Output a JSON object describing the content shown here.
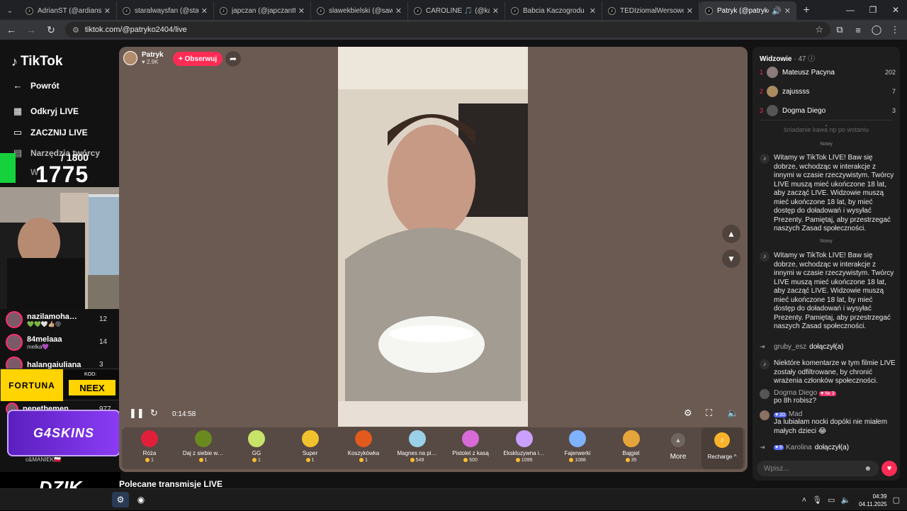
{
  "browser": {
    "tabs": [
      {
        "title": "AdrianST (@ardianstx) pr…",
        "active": false
      },
      {
        "title": "staralwaysfan (@staralwa…",
        "active": false
      },
      {
        "title": "japczan (@japczanttv) pr…",
        "active": false
      },
      {
        "title": "slawekbielski (@sawomirb…",
        "active": false
      },
      {
        "title": "CAROLINE 🎵 (@karolina…",
        "active": false
      },
      {
        "title": "Babcia Kaczogrodu (@ba…",
        "active": false
      },
      {
        "title": "TEDIziomalWersowokidz…",
        "active": false
      },
      {
        "title": "Patryk (@patryko2404)",
        "active": true
      }
    ],
    "url": "tiktok.com/@patryko2404/live"
  },
  "leftnav": {
    "logo": "TikTok",
    "back": "Powrót",
    "discover": "Odkryj LIVE",
    "go_live": "ZACZNIJ LIVE",
    "creator_tools": "Narzędzia twórcy",
    "partial_item": "W"
  },
  "overlay": {
    "counter_target": "/ 1800",
    "counter_value": "1775",
    "sponsor_fortuna": "FORTUNA",
    "code_label": "KOD:",
    "code_value": "NEEX",
    "g4skins": "G4SKINS",
    "dzik": "DZIK"
  },
  "following_live": [
    {
      "name": "nazilamoha…",
      "sub": "💚💚🤍👍🏼😝",
      "count": "12"
    },
    {
      "name": "84melaaa",
      "sub": "melka💜",
      "count": "14"
    },
    {
      "name": "halangaiuliana",
      "sub": "",
      "count": "3"
    },
    {
      "name": "pepethemen…",
      "sub": "",
      "count": "977"
    },
    {
      "name": "",
      "sub": "c&MANIEK🇵🇱",
      "count": ""
    }
  ],
  "player": {
    "host_name": "Patryk",
    "host_likes": "♥ 2.9K",
    "follow_label": "+ Obserwuj",
    "time": "0:14:58"
  },
  "gifts": [
    {
      "name": "Róża",
      "price": "1",
      "color": "#e0203a"
    },
    {
      "name": "Daj z siebie w…",
      "price": "1",
      "color": "#6a8a20"
    },
    {
      "name": "GG",
      "price": "1",
      "color": "#c8e36a"
    },
    {
      "name": "Super",
      "price": "1",
      "color": "#f2c12e"
    },
    {
      "name": "Koszykówka",
      "price": "1",
      "color": "#e25a1c"
    },
    {
      "name": "Magnes na pi…",
      "price": "549",
      "color": "#9ad1e8"
    },
    {
      "name": "Pistolet z kasą",
      "price": "500",
      "color": "#d86bd8"
    },
    {
      "name": "Ekskluzywna i…",
      "price": "1099",
      "color": "#c9a0ff"
    },
    {
      "name": "Fajerwerki",
      "price": "1088",
      "color": "#7fb2ff"
    },
    {
      "name": "Bajgiel",
      "price": "35",
      "color": "#e6a53a"
    }
  ],
  "more_label": "More",
  "recharge_label": "Recharge ^",
  "recommended_title": "Polecane transmisje LIVE",
  "chat": {
    "viewers_label": "Widzowie",
    "viewers_count": "· 47",
    "top_viewers": [
      {
        "rank": "1",
        "name": "Mateusz Pacyna",
        "score": "202"
      },
      {
        "rank": "2",
        "name": "zajussss",
        "score": "7"
      },
      {
        "rank": "3",
        "name": "Dogma Diego",
        "score": "3"
      }
    ],
    "faded_text": "śniadanie kawa np po wstaniu",
    "new_label": "Nowy",
    "system_welcome": "Witamy w TikTok LIVE! Baw się dobrze, wchodząc w interakcje z innymi w czasie rzeczywistym. Twórcy LIVE muszą mieć ukończone 18 lat, aby zacząć LIVE. Widzowie muszą mieć ukończone 18 lat, by mieć dostęp do doładowań i wysyłać Prezenty. Pamiętaj, aby przestrzegać naszych Zasad społeczności.",
    "join1_user": "gruby_esz",
    "join_text": "dołączył(a)",
    "filter_msg": "Niektóre komentarze w tym filmie LIVE zostały odfiltrowane, by chronić wrażenia członków społeczności.",
    "msg1_user": "Dogma Diego",
    "msg1_badge": "♥ № 3",
    "msg1_text": "po 8h robisz?",
    "msg2_badge": "♥ 20",
    "msg2_user": "Mad",
    "msg2_text": "Ja lubiałam nocki dopóki nie miałem małych dzieci 😂",
    "join2_badge": "♥ 8",
    "join2_user": "Karolina",
    "input_placeholder": "Wpisz..."
  },
  "taskbar": {
    "time": "04:39",
    "date": "04.11.2025"
  }
}
